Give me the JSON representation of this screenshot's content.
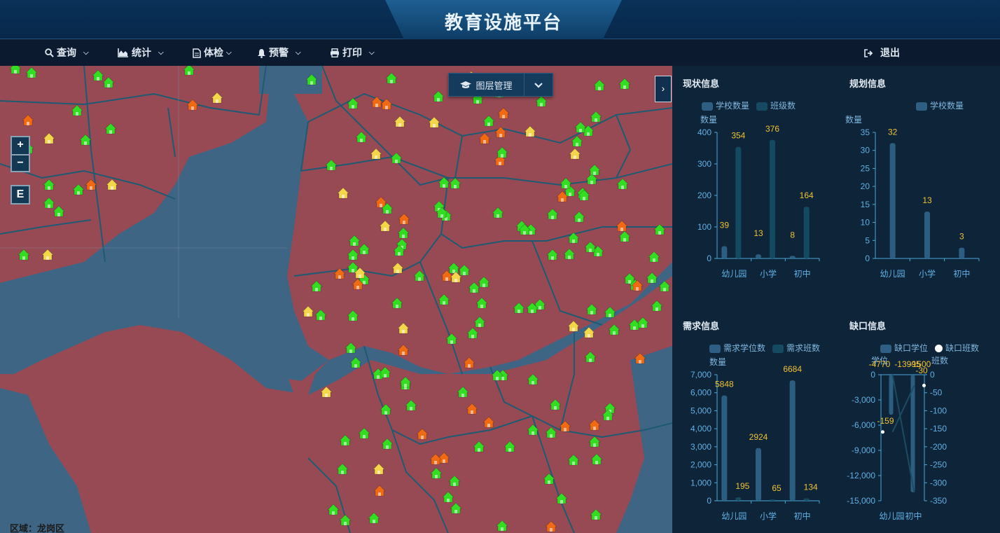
{
  "app": {
    "title": "教育设施平台"
  },
  "menu": [
    {
      "label": "查询",
      "icon": "search-icon"
    },
    {
      "label": "统计",
      "icon": "area-chart-icon"
    },
    {
      "label": "体检",
      "icon": "document-icon"
    },
    {
      "label": "预警",
      "icon": "bell-icon"
    },
    {
      "label": "打印",
      "icon": "print-icon"
    }
  ],
  "logout": {
    "label": "退出",
    "icon": "sign-out-icon"
  },
  "map": {
    "zoom_in": "+",
    "zoom_out": "−",
    "extent": "E",
    "layer_button": "图层管理",
    "region_label": "区域：龙岗区",
    "colors": {
      "land": "#974a54",
      "water": "#3f6585",
      "boundary": "#1d5a73",
      "green": "#33dd22",
      "yellow": "#f3d64a",
      "orange": "#f06a14"
    }
  },
  "panels": {
    "status": {
      "title": "现状信息",
      "legend": [
        "学校数量",
        "班级数"
      ],
      "y_unit": "数量"
    },
    "plan": {
      "title": "规划信息",
      "legend": [
        "学校数量"
      ],
      "y_unit": "数量"
    },
    "demand": {
      "title": "需求信息",
      "legend": [
        "需求学位数",
        "需求班数"
      ],
      "y_unit": "数量"
    },
    "gap": {
      "title": "缺口信息",
      "legend": [
        "缺口学位",
        "缺口班数"
      ],
      "y_unit_left": "学位",
      "y_unit_right": "班数"
    }
  },
  "chart_data": [
    {
      "type": "bar",
      "title": "现状信息",
      "categories": [
        "幼儿园",
        "小学",
        "初中"
      ],
      "series": [
        {
          "name": "学校数量",
          "values": [
            39,
            13,
            8
          ]
        },
        {
          "name": "班级数",
          "values": [
            354,
            376,
            164
          ]
        }
      ],
      "ylabel": "数量",
      "ylim": [
        0,
        400
      ],
      "yticks": [
        0,
        100,
        200,
        300,
        400
      ],
      "legend": "top"
    },
    {
      "type": "bar",
      "title": "规划信息",
      "categories": [
        "幼儿园",
        "小学",
        "初中"
      ],
      "series": [
        {
          "name": "学校数量",
          "values": [
            32,
            13,
            3
          ]
        }
      ],
      "ylabel": "数量",
      "ylim": [
        0,
        35
      ],
      "yticks": [
        0,
        5,
        10,
        15,
        20,
        25,
        30,
        35
      ],
      "legend": "top"
    },
    {
      "type": "bar",
      "title": "需求信息",
      "categories": [
        "幼儿园",
        "小学",
        "初中"
      ],
      "series": [
        {
          "name": "需求学位数",
          "values": [
            5848,
            2924,
            6684
          ]
        },
        {
          "name": "需求班数",
          "values": [
            195,
            65,
            134
          ]
        }
      ],
      "ylabel": "数量",
      "ylim": [
        0,
        7000
      ],
      "yticks": [
        "0",
        "1,000",
        "2,000",
        "3,000",
        "4,000",
        "5,000",
        "6,000",
        "7,000"
      ],
      "legend": "top"
    },
    {
      "type": "bar",
      "title": "缺口信息",
      "categories": [
        "幼儿园",
        "初中"
      ],
      "series": [
        {
          "name": "缺口学位",
          "values": [
            -4770,
            -13995
          ]
        },
        {
          "name": "缺口班数",
          "type": "line",
          "values": [
            -159,
            -30
          ]
        }
      ],
      "top_labels": [
        "-4770",
        "-13995",
        "-1500",
        "-30"
      ],
      "ylabel": "学位",
      "ylim": [
        -15000,
        0
      ],
      "yticks": [
        "0",
        "-3,000",
        "-6,000",
        "-9,000",
        "-12,000",
        "-15,000"
      ],
      "y2label": "班数",
      "y2lim": [
        -350,
        0
      ],
      "y2ticks": [
        "0",
        "-50",
        "-100",
        "-150",
        "-200",
        "-250",
        "-300",
        "-350"
      ],
      "legend": "top"
    }
  ]
}
